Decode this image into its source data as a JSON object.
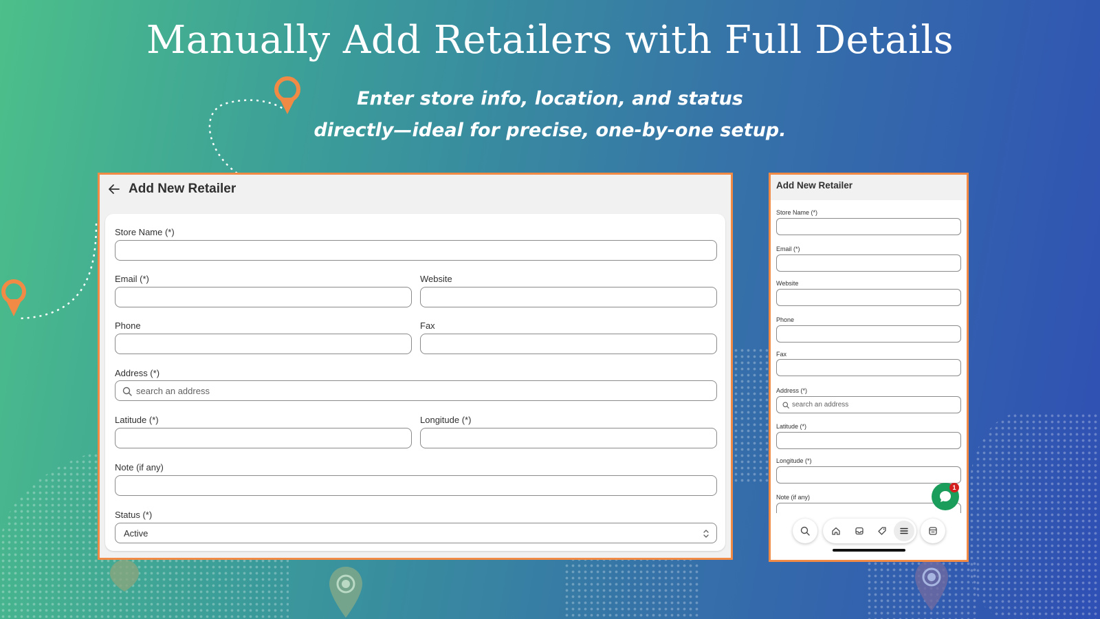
{
  "banner": {
    "title": "Manually Add Retailers with Full Details",
    "subtitle_line1": "Enter store info, location, and status",
    "subtitle_line2": "directly—ideal for precise, one-by-one setup."
  },
  "colors": {
    "accent_orange": "#f08a45",
    "chat_green": "#1a9d5b",
    "badge_red": "#d41f1f"
  },
  "desktop_form": {
    "title": "Add New Retailer",
    "fields": {
      "store_name_label": "Store Name (*)",
      "email_label": "Email (*)",
      "website_label": "Website",
      "phone_label": "Phone",
      "fax_label": "Fax",
      "address_label": "Address (*)",
      "address_placeholder": "search an address",
      "latitude_label": "Latitude (*)",
      "longitude_label": "Longitude (*)",
      "note_label": "Note (if any)",
      "status_label": "Status (*)",
      "status_value": "Active"
    }
  },
  "mobile_form": {
    "title": "Add New Retailer",
    "fields": {
      "store_name_label": "Store Name (*)",
      "email_label": "Email (*)",
      "website_label": "Website",
      "phone_label": "Phone",
      "fax_label": "Fax",
      "address_label": "Address (*)",
      "address_placeholder": "search an address",
      "latitude_label": "Latitude (*)",
      "longitude_label": "Longitude (*)",
      "note_label": "Note (if any)"
    },
    "chat_badge_count": "1",
    "nav_icons": [
      "search-icon",
      "home-icon",
      "inbox-icon",
      "tag-icon",
      "menu-icon",
      "store-icon"
    ]
  }
}
